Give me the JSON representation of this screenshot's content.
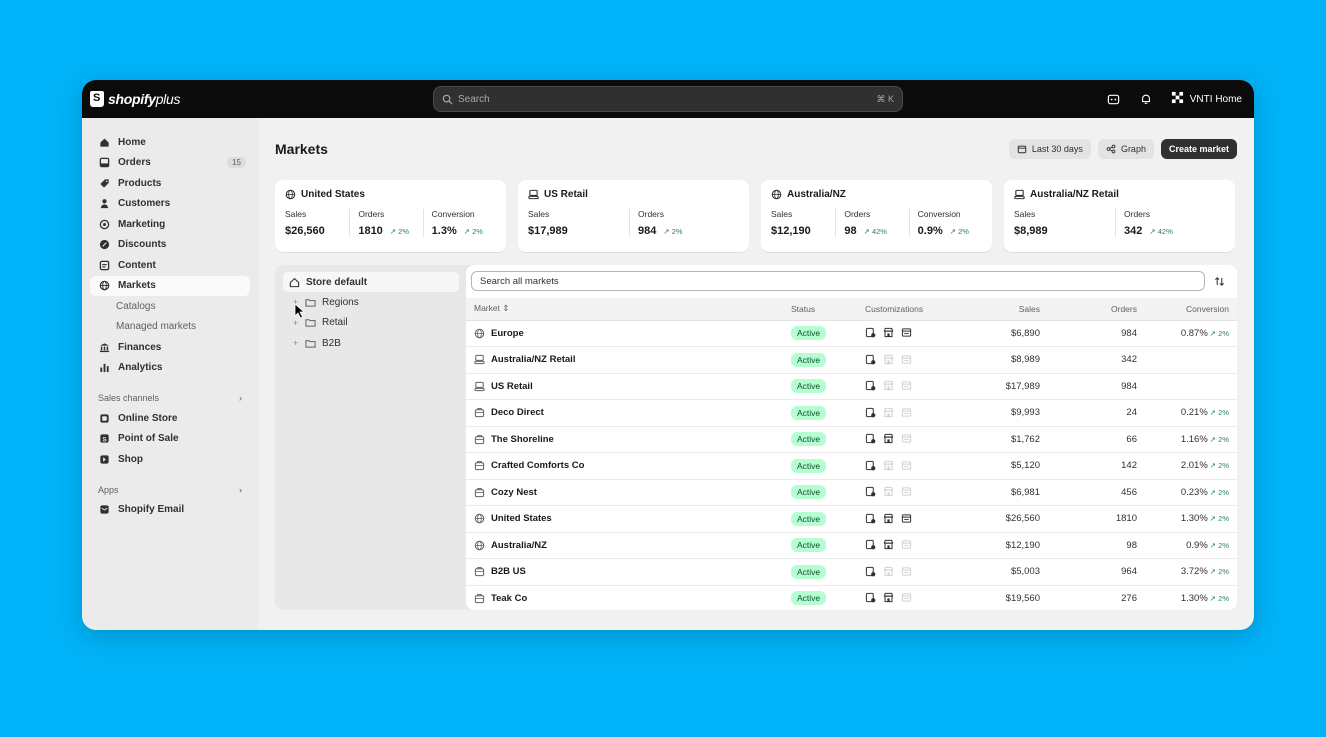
{
  "app": {
    "brand": "shopify",
    "brand_suffix": "plus"
  },
  "search": {
    "placeholder": "Search",
    "shortcut": "⌘ K"
  },
  "store": {
    "name": "VNTI Home"
  },
  "sidebar": {
    "items": [
      {
        "label": "Home",
        "icon": "home-icon"
      },
      {
        "label": "Orders",
        "icon": "orders-icon",
        "badge": "15"
      },
      {
        "label": "Products",
        "icon": "tag-icon"
      },
      {
        "label": "Customers",
        "icon": "person-icon"
      },
      {
        "label": "Marketing",
        "icon": "target-icon"
      },
      {
        "label": "Discounts",
        "icon": "discount-icon"
      },
      {
        "label": "Content",
        "icon": "content-icon"
      },
      {
        "label": "Markets",
        "icon": "globe-icon",
        "active": true
      }
    ],
    "markets_sub": [
      "Catalogs",
      "Managed markets"
    ],
    "items2": [
      {
        "label": "Finances",
        "icon": "bank-icon"
      },
      {
        "label": "Analytics",
        "icon": "chart-icon"
      }
    ],
    "sales_channels_title": "Sales channels",
    "sales_channels": [
      {
        "label": "Online Store"
      },
      {
        "label": "Point of Sale"
      },
      {
        "label": "Shop"
      }
    ],
    "apps_title": "Apps",
    "apps": [
      {
        "label": "Shopify Email"
      }
    ]
  },
  "page": {
    "title": "Markets",
    "date_range": "Last 30 days",
    "graph": "Graph",
    "create": "Create market"
  },
  "cards": [
    {
      "title": "United States",
      "metrics": [
        {
          "label": "Sales",
          "value": "$26,560",
          "change": ""
        },
        {
          "label": "Orders",
          "value": "1810",
          "change": "↗ 2%"
        },
        {
          "label": "Conversion",
          "value": "1.3%",
          "change": "↗ 2%"
        }
      ]
    },
    {
      "title": "US Retail",
      "metrics": [
        {
          "label": "Sales",
          "value": "$17,989",
          "change": ""
        },
        {
          "label": "Orders",
          "value": "984",
          "change": "↗ 2%"
        }
      ]
    },
    {
      "title": "Australia/NZ",
      "metrics": [
        {
          "label": "Sales",
          "value": "$12,190",
          "change": ""
        },
        {
          "label": "Orders",
          "value": "98",
          "change": "↗ 42%"
        },
        {
          "label": "Conversion",
          "value": "0.9%",
          "change": "↗ 2%"
        }
      ]
    },
    {
      "title": "Australia/NZ Retail",
      "metrics": [
        {
          "label": "Sales",
          "value": "$8,989",
          "change": ""
        },
        {
          "label": "Orders",
          "value": "342",
          "change": "↗ 42%"
        }
      ]
    }
  ],
  "tree": {
    "root": "Store default",
    "folders": [
      "Regions",
      "Retail",
      "B2B"
    ]
  },
  "table": {
    "search_placeholder": "Search all markets",
    "headers": {
      "market": "Market",
      "status": "Status",
      "customizations": "Customizations",
      "sales": "Sales",
      "orders": "Orders",
      "conversion": "Conversion"
    },
    "rows": [
      {
        "name": "Europe",
        "status": "Active",
        "sales": "$6,890",
        "orders": "984",
        "conv": "0.87%",
        "chg": "↗ 2%"
      },
      {
        "name": "Australia/NZ Retail",
        "status": "Active",
        "sales": "$8,989",
        "orders": "342",
        "conv": "",
        "chg": ""
      },
      {
        "name": "US Retail",
        "status": "Active",
        "sales": "$17,989",
        "orders": "984",
        "conv": "",
        "chg": ""
      },
      {
        "name": "Deco Direct",
        "status": "Active",
        "sales": "$9,993",
        "orders": "24",
        "conv": "0.21%",
        "chg": "↗ 2%"
      },
      {
        "name": "The Shoreline",
        "status": "Active",
        "sales": "$1,762",
        "orders": "66",
        "conv": "1.16%",
        "chg": "↗ 2%"
      },
      {
        "name": "Crafted Comforts Co",
        "status": "Active",
        "sales": "$5,120",
        "orders": "142",
        "conv": "2.01%",
        "chg": "↗ 2%"
      },
      {
        "name": "Cozy Nest",
        "status": "Active",
        "sales": "$6,981",
        "orders": "456",
        "conv": "0.23%",
        "chg": "↗ 2%"
      },
      {
        "name": "United States",
        "status": "Active",
        "sales": "$26,560",
        "orders": "1810",
        "conv": "1.30%",
        "chg": "↗ 2%"
      },
      {
        "name": "Australia/NZ",
        "status": "Active",
        "sales": "$12,190",
        "orders": "98",
        "conv": "0.9%",
        "chg": "↗ 2%"
      },
      {
        "name": "B2B US",
        "status": "Active",
        "sales": "$5,003",
        "orders": "964",
        "conv": "3.72%",
        "chg": "↗ 2%"
      },
      {
        "name": "Teak Co",
        "status": "Active",
        "sales": "$19,560",
        "orders": "276",
        "conv": "1.30%",
        "chg": "↗ 2%"
      }
    ]
  },
  "colors": {
    "background": "#00b2f7",
    "topbar": "#0b0b0b",
    "active_badge": "#b4fed2",
    "positive": "#29845a"
  }
}
